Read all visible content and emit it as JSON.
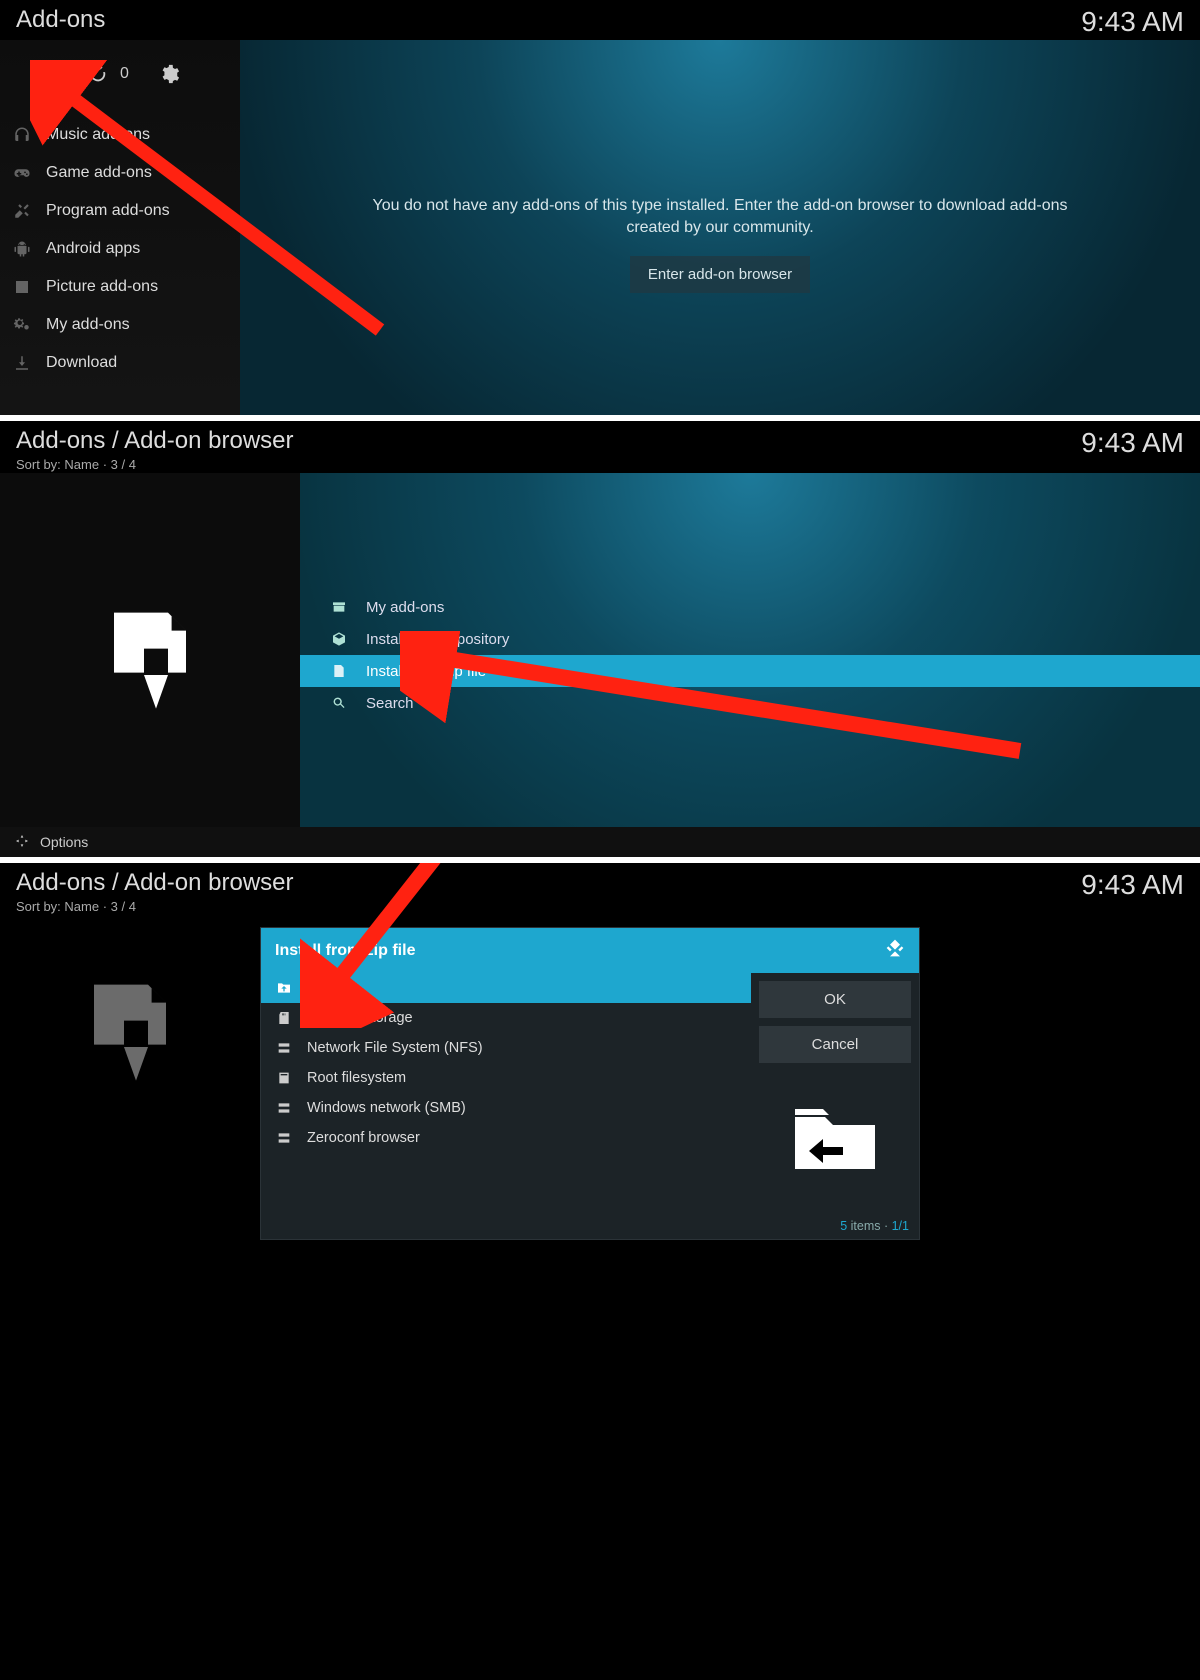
{
  "time": "9:43 AM",
  "panel1": {
    "title": "Add-ons",
    "toolbar": {
      "count": "0"
    },
    "nav": [
      {
        "label": "Music add-ons"
      },
      {
        "label": "Game add-ons"
      },
      {
        "label": "Program add-ons"
      },
      {
        "label": "Android apps"
      },
      {
        "label": "Picture add-ons"
      },
      {
        "label": "My add-ons"
      },
      {
        "label": "Download"
      }
    ],
    "empty_msg": "You do not have any add-ons of this type installed. Enter the add-on browser to download add-ons created by our community.",
    "browser_btn": "Enter add-on browser"
  },
  "panel2": {
    "title": "Add-ons / Add-on browser",
    "sub": "Sort by: Name  ·  3 / 4",
    "menu": [
      {
        "label": "My add-ons"
      },
      {
        "label": "Install from repository"
      },
      {
        "label": "Install from zip file"
      },
      {
        "label": "Search"
      }
    ],
    "options": "Options"
  },
  "panel3": {
    "title": "Add-ons / Add-on browser",
    "sub": "Sort by: Name  ·  3 / 4",
    "dialog_title": "Install from zip file",
    "ok": "OK",
    "cancel": "Cancel",
    "files": [
      {
        "label": ".."
      },
      {
        "label": "External storage"
      },
      {
        "label": "Network File System (NFS)"
      },
      {
        "label": "Root filesystem"
      },
      {
        "label": "Windows network (SMB)"
      },
      {
        "label": "Zeroconf browser"
      }
    ],
    "count_num": "5",
    "count_label": " items · ",
    "count_pos": "1/1"
  }
}
